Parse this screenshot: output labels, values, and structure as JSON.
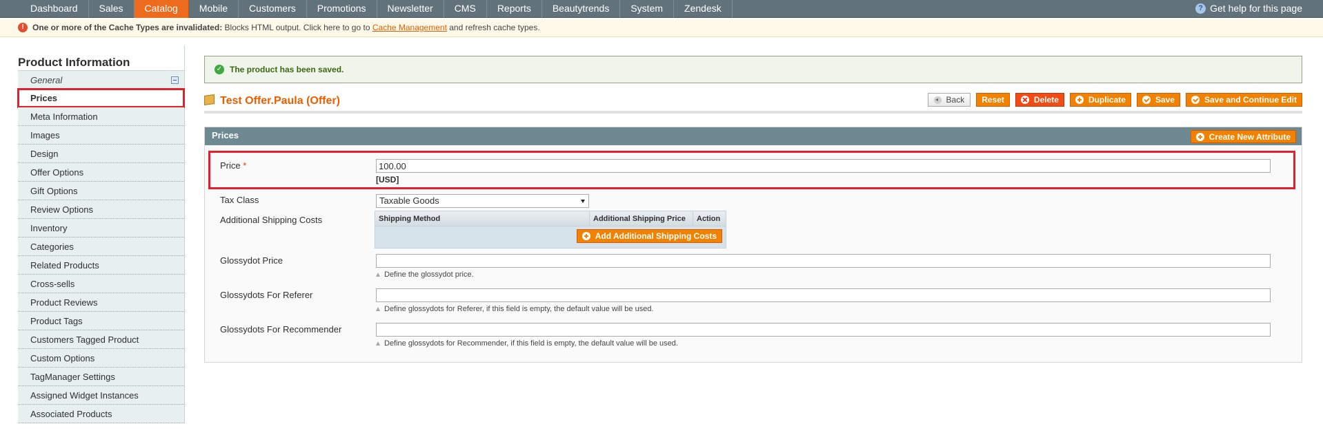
{
  "nav": {
    "items": [
      "Dashboard",
      "Sales",
      "Catalog",
      "Mobile",
      "Customers",
      "Promotions",
      "Newsletter",
      "CMS",
      "Reports",
      "Beautytrends",
      "System",
      "Zendesk"
    ],
    "active": "Catalog",
    "help": "Get help for this page"
  },
  "notice": {
    "bold": "One or more of the Cache Types are invalidated:",
    "text_before": " Blocks HTML output. Click here to go to ",
    "link": "Cache Management",
    "text_after": " and refresh cache types."
  },
  "sidebar": {
    "title": "Product Information",
    "group": "General",
    "items": [
      "Prices",
      "Meta Information",
      "Images",
      "Design",
      "Offer Options",
      "Gift Options",
      "Review Options",
      "Inventory",
      "Categories",
      "Related Products",
      "Cross-sells",
      "Product Reviews",
      "Product Tags",
      "Customers Tagged Product",
      "Custom Options",
      "TagManager Settings",
      "Assigned Widget Instances",
      "Associated Products"
    ],
    "selected": "Prices"
  },
  "success": "The product has been saved.",
  "page": {
    "title": "Test Offer.Paula (Offer)",
    "buttons": {
      "back": "Back",
      "reset": "Reset",
      "delete": "Delete",
      "duplicate": "Duplicate",
      "save": "Save",
      "save_continue": "Save and Continue Edit"
    }
  },
  "prices": {
    "legend": "Prices",
    "create_attr": "Create New Attribute",
    "price_label": "Price",
    "required_mark": "*",
    "price_value": "100.00",
    "currency": "[USD]",
    "tax_label": "Tax Class",
    "tax_value": "Taxable Goods",
    "shipping_label": "Additional Shipping Costs",
    "shipping_cols": [
      "Shipping Method",
      "Additional Shipping Price",
      "Action"
    ],
    "add_shipping": "Add Additional Shipping Costs",
    "glossy_label": "Glossydot Price",
    "glossy_value": "",
    "glossy_note": "Define the glossydot price.",
    "referer_label": "Glossydots For Referer",
    "referer_value": "",
    "referer_note": "Define glossydots for Referer, if this field is empty, the default value will be used.",
    "recommender_label": "Glossydots For Recommender",
    "recommender_value": "",
    "recommender_note": "Define glossydots for Recommender, if this field is empty, the default value will be used."
  }
}
